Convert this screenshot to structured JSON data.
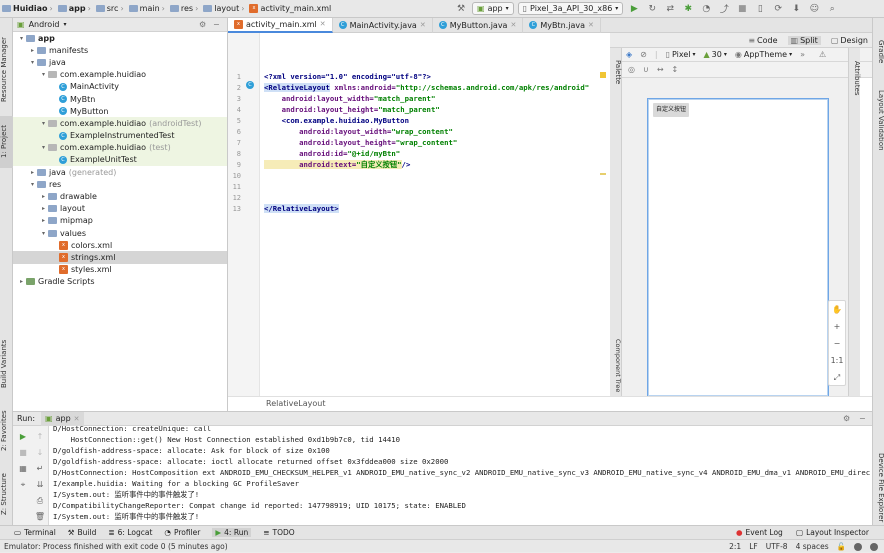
{
  "navbar": {
    "crumbs": [
      "Huidiao",
      "app",
      "src",
      "main",
      "res",
      "layout",
      "activity_main.xml"
    ],
    "run_config": "app",
    "device": "Pixel_3a_API_30_x86"
  },
  "left_tools": {
    "resource_manager": "Resource Manager",
    "project": "1: Project",
    "build_variants": "Build Variants",
    "favorites": "2: Favorites",
    "structure": "Z: Structure"
  },
  "right_tools": {
    "gradle": "Gradle",
    "layout_validation": "Layout Validation",
    "device_file_explorer": "Device File Explorer"
  },
  "project": {
    "view_mode": "Android",
    "tree": [
      {
        "label": "app",
        "extra": "",
        "kind": "folder",
        "level": 0,
        "arrow": "▾",
        "bold": true
      },
      {
        "label": "manifests",
        "extra": "",
        "kind": "folder",
        "level": 1,
        "arrow": "▸"
      },
      {
        "label": "java",
        "extra": "",
        "kind": "folder",
        "level": 1,
        "arrow": "▾"
      },
      {
        "label": "com.example.huidiao",
        "extra": "",
        "kind": "package",
        "level": 2,
        "arrow": "▾"
      },
      {
        "label": "MainActivity",
        "extra": "",
        "kind": "class",
        "level": 3,
        "arrow": ""
      },
      {
        "label": "MyBtn",
        "extra": "",
        "kind": "class",
        "level": 3,
        "arrow": ""
      },
      {
        "label": "MyButton",
        "extra": "",
        "kind": "class",
        "level": 3,
        "arrow": ""
      },
      {
        "label": "com.example.huidiao",
        "extra": "(androidTest)",
        "kind": "package",
        "level": 2,
        "arrow": "▾",
        "test": true
      },
      {
        "label": "ExampleInstrumentedTest",
        "extra": "",
        "kind": "class",
        "level": 3,
        "arrow": "",
        "test": true
      },
      {
        "label": "com.example.huidiao",
        "extra": "(test)",
        "kind": "package",
        "level": 2,
        "arrow": "▾",
        "test": true
      },
      {
        "label": "ExampleUnitTest",
        "extra": "",
        "kind": "class",
        "level": 3,
        "arrow": "",
        "test": true
      },
      {
        "label": "java",
        "extra": "(generated)",
        "kind": "folder",
        "level": 1,
        "arrow": "▸"
      },
      {
        "label": "res",
        "extra": "",
        "kind": "folder",
        "level": 1,
        "arrow": "▾"
      },
      {
        "label": "drawable",
        "extra": "",
        "kind": "folder",
        "level": 2,
        "arrow": "▸"
      },
      {
        "label": "layout",
        "extra": "",
        "kind": "folder",
        "level": 2,
        "arrow": "▸"
      },
      {
        "label": "mipmap",
        "extra": "",
        "kind": "folder",
        "level": 2,
        "arrow": "▸"
      },
      {
        "label": "values",
        "extra": "",
        "kind": "folder",
        "level": 2,
        "arrow": "▾"
      },
      {
        "label": "colors.xml",
        "extra": "",
        "kind": "xml",
        "level": 3,
        "arrow": ""
      },
      {
        "label": "strings.xml",
        "extra": "",
        "kind": "xml",
        "level": 3,
        "arrow": "",
        "selected": true
      },
      {
        "label": "styles.xml",
        "extra": "",
        "kind": "xml",
        "level": 3,
        "arrow": ""
      },
      {
        "label": "Gradle Scripts",
        "extra": "",
        "kind": "gradle",
        "level": 0,
        "arrow": "▸"
      }
    ]
  },
  "editor": {
    "tabs": [
      {
        "label": "activity_main.xml",
        "kind": "xml",
        "active": true
      },
      {
        "label": "MainActivity.java",
        "kind": "class",
        "active": false
      },
      {
        "label": "MyButton.java",
        "kind": "class",
        "active": false
      },
      {
        "label": "MyBtn.java",
        "kind": "class",
        "active": false
      }
    ],
    "line_numbers": [
      "1",
      "2",
      "3",
      "4",
      "5",
      "6",
      "7",
      "8",
      "9",
      "10",
      "11",
      "12",
      "13"
    ],
    "code": {
      "l1": "<?xml version=\"1.0\" encoding=\"utf-8\"?>",
      "l2_tag": "<RelativeLayout",
      "l2_attr": " xmlns:android=",
      "l2_val": "\"http://schemas.android.com/apk/res/android\"",
      "l3_attr": "    android:layout_width=",
      "l3_val": "\"match_parent\"",
      "l4_attr": "    android:layout_height=",
      "l4_val": "\"match_parent\"",
      "l5_tag": "    <com.example.huidiao.MyButton",
      "l6_attr": "        android:layout_width=",
      "l6_val": "\"wrap_content\"",
      "l7_attr": "        android:layout_height=",
      "l7_val": "\"wrap_content\"",
      "l8_attr": "        android:id=",
      "l8_val": "\"@+id/myBtn\"",
      "l9_attr": "        android:text=",
      "l9_val": "\"自定义按钮\"",
      "l9_end": "/>",
      "l13_tag": "</RelativeLayout>"
    },
    "breadcrumb_status": "RelativeLayout"
  },
  "design": {
    "modes": [
      "Code",
      "Split",
      "Design"
    ],
    "active_mode": "Split",
    "palette": "Palette",
    "component_tree": "Component Tree",
    "attributes": "Attributes",
    "device": "Pixel",
    "api": "30",
    "theme": "AppTheme",
    "preview_button_text": "自定义按钮",
    "zoom_controls": [
      "✋",
      "+",
      "−",
      "1:1",
      "⤢"
    ]
  },
  "run": {
    "title": "Run:",
    "config": "app",
    "console_lines": [
      "D/HostConnection: createUnique: call",
      "    HostConnection::get() New Host Connection established 0xd1b9b7c0, tid 14410",
      "D/goldfish-address-space: allocate: Ask for block of size 0x100",
      "D/goldfish-address-space: allocate: ioctl allocate returned offset 0x3fddea000 size 0x2000",
      "D/HostConnection: HostComposition ext ANDROID_EMU_CHECKSUM_HELPER_v1 ANDROID_EMU_native_sync_v2 ANDROID_EMU_native_sync_v3 ANDROID_EMU_native_sync_v4 ANDROID_EMU_dma_v1 ANDROID_EMU_direct_me",
      "I/example.huidia: Waiting for a blocking GC ProfileSaver",
      "I/System.out: 监听事件中的事件触发了!",
      "D/CompatibilityChangeReporter: Compat change id reported: 147798919; UID 10175; state: ENABLED",
      "I/System.out: 监听事件中的事件触发了!"
    ]
  },
  "bottom_tabs": [
    "Terminal",
    "Build",
    "6: Logcat",
    "Profiler",
    "4: Run",
    "TODO"
  ],
  "bottom_right": [
    "Event Log",
    "Layout Inspector"
  ],
  "status": {
    "message": "Emulator: Process finished with exit code 0 (5 minutes ago)",
    "position": "2:1",
    "line_sep": "LF",
    "encoding": "UTF-8",
    "indent": "4 spaces"
  },
  "colors": {
    "accent": "#4a89dc",
    "tag": "#000080",
    "attr": "#660e7a",
    "value": "#008000"
  }
}
